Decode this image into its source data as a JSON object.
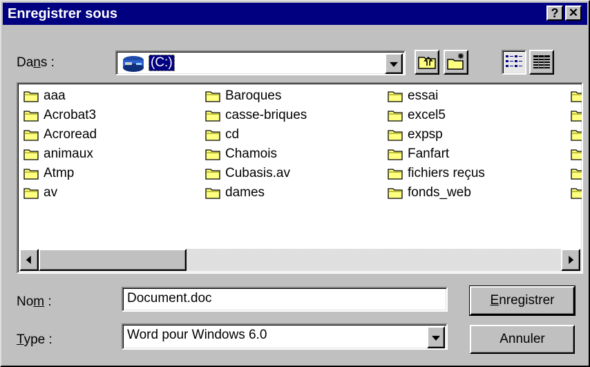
{
  "window": {
    "title": "Enregistrer sous",
    "help_glyph": "?",
    "close_glyph": "✕"
  },
  "location": {
    "label_pre": "Da",
    "label_accel": "n",
    "label_post": "s :",
    "drive": "(C:)"
  },
  "files": {
    "columns": [
      [
        "aaa",
        "Acrobat3",
        "Acroread",
        "animaux",
        "Atmp",
        "av"
      ],
      [
        "Baroques",
        "casse-briques",
        "cd",
        "Chamois",
        "Cubasis.av",
        "dames"
      ],
      [
        "essai",
        "excel5",
        "expsp",
        "Fanfart",
        "fichiers reçus",
        "fonds_web"
      ]
    ]
  },
  "filename": {
    "label_pre": "No",
    "label_accel": "m",
    "label_post": " :",
    "value": "Document.doc"
  },
  "filetype": {
    "label_accel": "T",
    "label_post": "ype :",
    "value": "Word pour Windows 6.0"
  },
  "buttons": {
    "save_accel": "E",
    "save_rest": "nregistrer",
    "cancel": "Annuler"
  },
  "colors": {
    "titlebar": "#000080",
    "face": "#c0c0c0",
    "folder": "#ffff80"
  },
  "icons": {
    "drive": "hard-drive-icon",
    "up": "up-one-level-icon",
    "new_folder": "new-folder-icon",
    "list_view": "list-view-icon",
    "details_view": "details-view-icon",
    "folder": "folder-icon"
  }
}
